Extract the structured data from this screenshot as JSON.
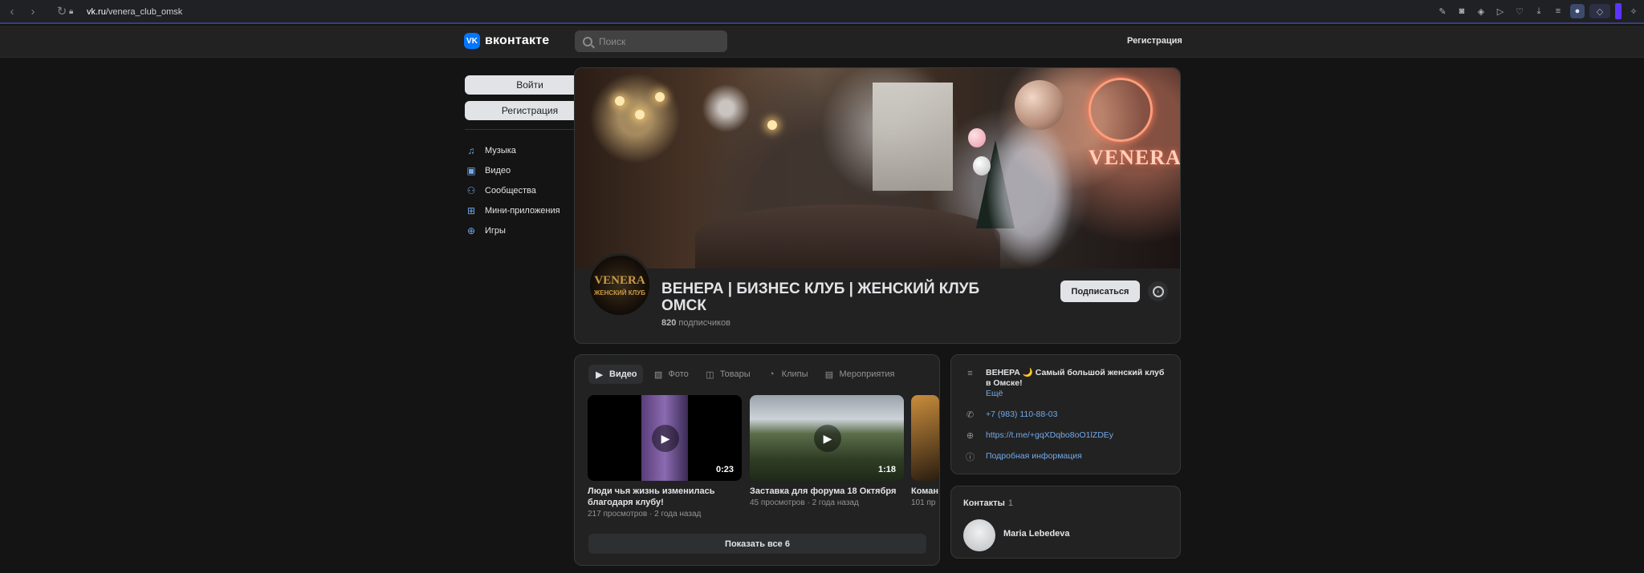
{
  "browser": {
    "url_host": "vk.ru",
    "url_path": "/venera_club_omsk"
  },
  "header": {
    "logo_text": "вконтакте",
    "search_placeholder": "Поиск",
    "register": "Регистрация"
  },
  "sidebar": {
    "login_button": "Войти",
    "register_button": "Регистрация",
    "items": [
      {
        "label": "Музыка",
        "icon": "music-icon"
      },
      {
        "label": "Видео",
        "icon": "video-icon"
      },
      {
        "label": "Сообщества",
        "icon": "communities-icon"
      },
      {
        "label": "Мини-приложения",
        "icon": "apps-icon"
      },
      {
        "label": "Игры",
        "icon": "games-icon"
      }
    ]
  },
  "group": {
    "cover_sign": "VENERA",
    "avatar_line1": "VENERA",
    "avatar_line2": "ЖЕНСКИЙ КЛУБ",
    "title": "ВЕНЕРА | БИЗНЕС КЛУБ | ЖЕНСКИЙ КЛУБ ОМСК",
    "subscribers_count": "820",
    "subscribers_label": "подписчиков",
    "subscribe_button": "Подписаться"
  },
  "media": {
    "tabs": [
      {
        "label": "Видео",
        "active": true
      },
      {
        "label": "Фото",
        "active": false
      },
      {
        "label": "Товары",
        "active": false
      },
      {
        "label": "Клипы",
        "active": false
      },
      {
        "label": "Мероприятия",
        "active": false
      }
    ],
    "videos": [
      {
        "title": "Люди чья жизнь изменилась благодаря клубу!",
        "duration": "0:23",
        "views": "217 просмотров",
        "age": "2 года назад"
      },
      {
        "title": "Заставка для форума 18 Октября",
        "duration": "1:18",
        "views": "45 просмотров",
        "age": "2 года назад"
      },
      {
        "title": "Коман",
        "duration": "",
        "views": "101 пр",
        "age": ""
      }
    ],
    "show_all": "Показать все 6"
  },
  "info": {
    "description": "ВЕНЕРА 🌙 Самый большой женский клуб в Омске!",
    "more": "Ещё",
    "phone": "+7 (983) 110-88-03",
    "website": "https://t.me/+gqXDqbo8oO1lZDEy",
    "details": "Подробная информация"
  },
  "contacts": {
    "title": "Контакты",
    "count": "1",
    "name": "Maria Lebedeva"
  }
}
